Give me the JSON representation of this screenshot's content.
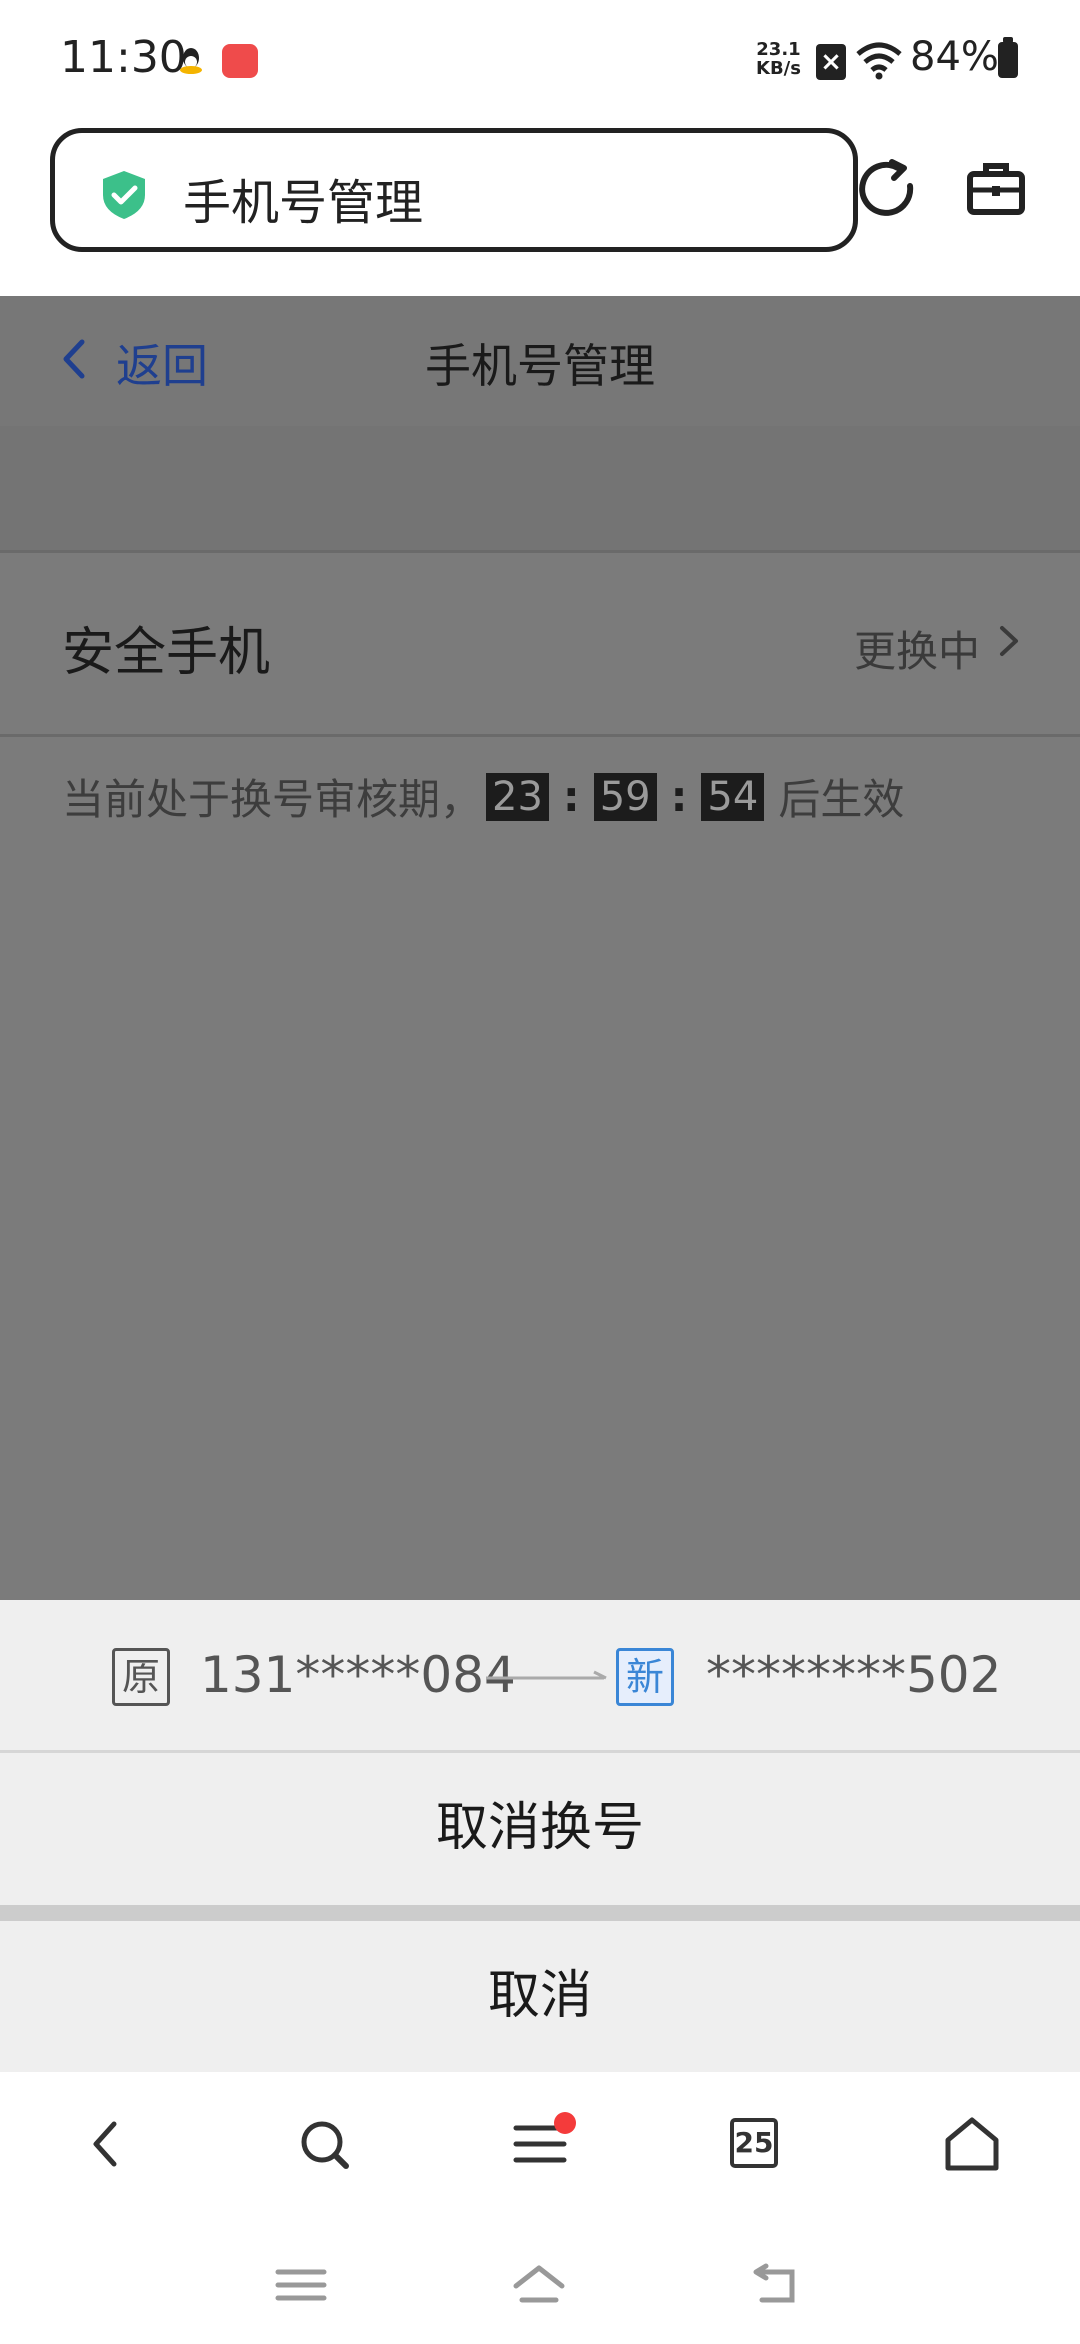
{
  "status_bar": {
    "time": "11:30",
    "net_speed_value": "23.1",
    "net_speed_unit": "KB/s",
    "battery": "84%",
    "icons": [
      "qq-icon",
      "huawei-app-icon",
      "sim-off-icon",
      "wifi-icon",
      "battery-icon"
    ]
  },
  "browser": {
    "url_title": "手机号管理",
    "icons": [
      "shield-check-icon",
      "reload-icon",
      "toolbox-icon"
    ]
  },
  "page": {
    "back_label": "返回",
    "title": "手机号管理",
    "row_label": "安全手机",
    "row_status": "更换中",
    "notice_prefix": "当前处于换号审核期，",
    "countdown": {
      "hours": "23",
      "minutes": "59",
      "seconds": "54"
    },
    "colon": ":",
    "notice_suffix": "后生效"
  },
  "sheet": {
    "old_tag": "原",
    "old_number": "131*****084",
    "new_tag": "新",
    "new_number": "********502",
    "cancel_change_label": "取消换号",
    "cancel_label": "取消"
  },
  "toolbar": {
    "tab_count": "25",
    "icons": [
      "back-icon",
      "search-icon",
      "menu-icon",
      "tabs-icon",
      "home-icon"
    ]
  },
  "colors": {
    "accent_blue": "#3a86d6",
    "shield_green": "#3cc08a",
    "dim_overlay": "#7b7b7b",
    "notification_red": "#f43b3b"
  }
}
